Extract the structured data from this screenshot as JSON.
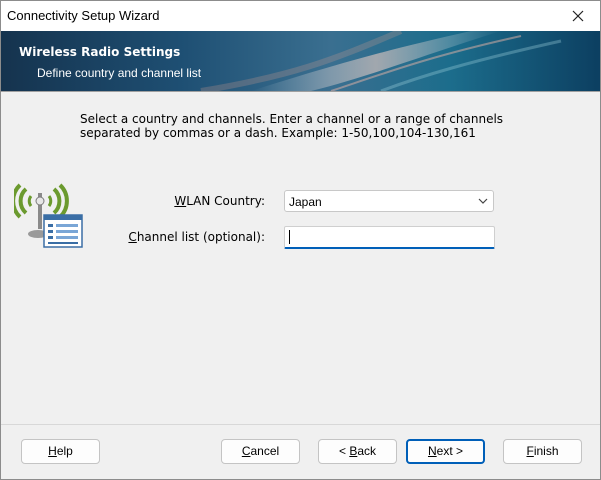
{
  "window": {
    "title": "Connectivity Setup Wizard"
  },
  "banner": {
    "title": "Wireless Radio Settings",
    "subtitle": "Define country and channel list"
  },
  "instructions": {
    "line1": "Select a country and channels. Enter a channel or a range of channels",
    "line2": "separated by commas or a dash. Example: 1-50,100,104-130,161"
  },
  "form": {
    "wlan_country": {
      "label_mnemonic": "W",
      "label_rest": "LAN Country:",
      "value": "Japan"
    },
    "channel_list": {
      "label_mnemonic": "C",
      "label_rest": "hannel list (optional):",
      "value": ""
    }
  },
  "buttons": {
    "help": {
      "mnemonic": "H",
      "rest": "elp"
    },
    "cancel": {
      "mnemonic": "C",
      "rest": "ancel"
    },
    "back": {
      "prefix": "< ",
      "mnemonic": "B",
      "rest": "ack"
    },
    "next": {
      "mnemonic": "N",
      "rest": "ext >"
    },
    "finish": {
      "mnemonic": "F",
      "rest": "inish"
    }
  },
  "icons": {
    "close": "close-icon",
    "wireless": "wireless-radio-icon",
    "dropdown": "chevron-down-icon"
  },
  "colors": {
    "accent": "#005fb8",
    "banner_dark": "#15334e",
    "banner_teal": "#1c6d8c",
    "wifi_green": "#6b9a2e"
  }
}
